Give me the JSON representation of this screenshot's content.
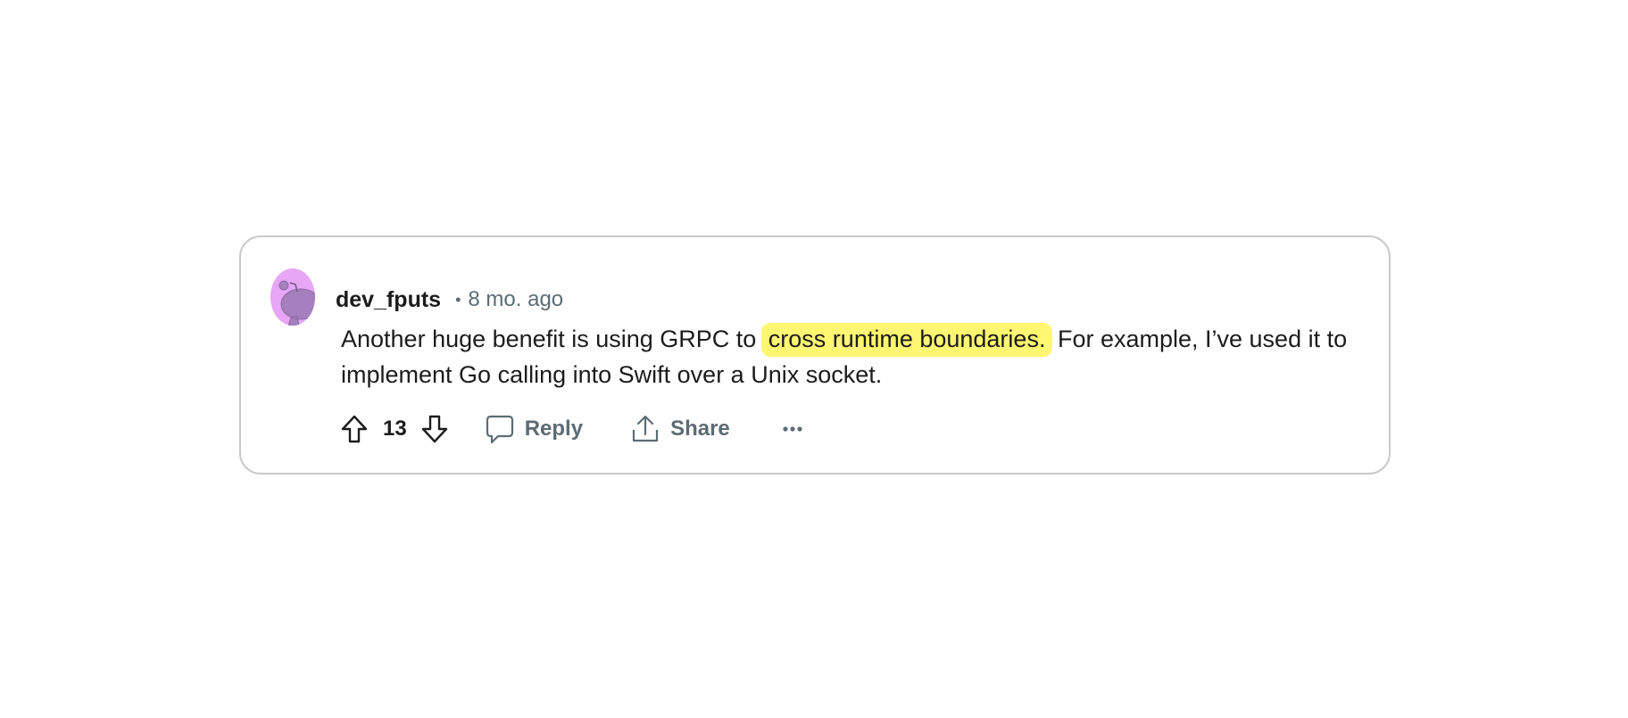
{
  "comment": {
    "author": "dev_fputs",
    "separator": "•",
    "time_ago": "8 mo. ago",
    "text_before": "Another huge benefit is using GRPC to",
    "text_highlight": "cross runtime boundaries.",
    "text_after": "For example, I’ve used it to implement Go calling into Swift over a Unix socket.",
    "highlight_color": "#fff671",
    "avatar_color": "#e7a6f6"
  },
  "actions": {
    "vote_count": "13",
    "reply_label": "Reply",
    "share_label": "Share",
    "more_label": "···"
  },
  "icons": {
    "upvote": "upvote-arrow-icon",
    "downvote": "downvote-arrow-icon",
    "reply": "speech-bubble-icon",
    "share": "share-upload-icon",
    "avatar": "snoo-avatar-icon"
  }
}
